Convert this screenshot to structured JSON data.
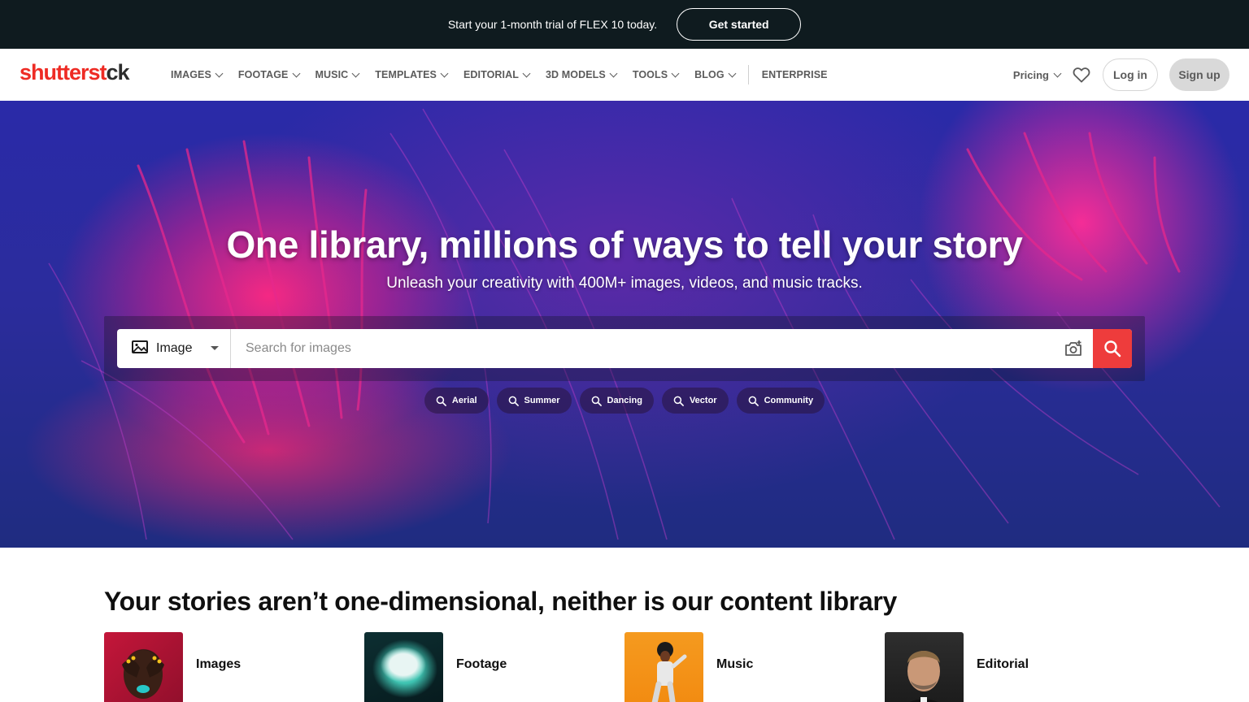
{
  "promo": {
    "text": "Start your 1-month trial of FLEX 10 today.",
    "button_label": "Get started"
  },
  "header": {
    "logo": {
      "part1": "shutterst",
      "part2": "ck"
    },
    "nav": [
      {
        "label": "IMAGES",
        "dropdown": true
      },
      {
        "label": "FOOTAGE",
        "dropdown": true
      },
      {
        "label": "MUSIC",
        "dropdown": true
      },
      {
        "label": "TEMPLATES",
        "dropdown": true
      },
      {
        "label": "EDITORIAL",
        "dropdown": true
      },
      {
        "label": "3D MODELS",
        "dropdown": true
      },
      {
        "label": "TOOLS",
        "dropdown": true
      },
      {
        "label": "BLOG",
        "dropdown": true
      },
      {
        "label": "ENTERPRISE",
        "dropdown": false
      }
    ],
    "pricing_label": "Pricing",
    "login_label": "Log in",
    "signup_label": "Sign up"
  },
  "hero": {
    "title": "One library, millions of ways to tell your story",
    "subtitle": "Unleash your creativity with 400M+ images, videos, and music tracks.",
    "search": {
      "type_selected": "Image",
      "placeholder": "Search for images"
    },
    "chips": [
      "Aerial",
      "Summer",
      "Dancing",
      "Vector",
      "Community"
    ]
  },
  "content": {
    "title": "Your stories aren’t one-dimensional, neither is our content library",
    "cards": [
      {
        "label": "Images"
      },
      {
        "label": "Footage"
      },
      {
        "label": "Music"
      },
      {
        "label": "Editorial"
      }
    ]
  },
  "colors": {
    "brand_red": "#ee2b24",
    "search_button": "#ee3c3c",
    "promo_bg": "#0f1b1f"
  }
}
